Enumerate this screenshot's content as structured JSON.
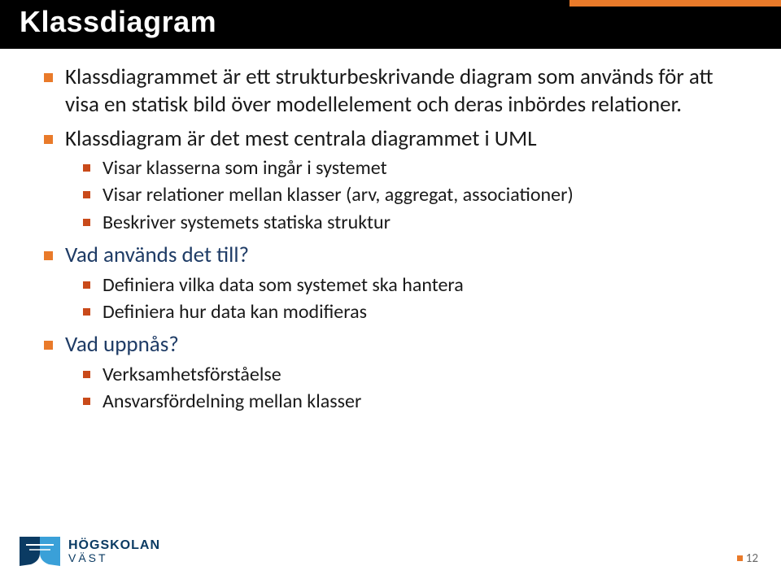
{
  "title": "Klassdiagram",
  "bullets": {
    "b1": "Klassdiagrammet är ett strukturbeskrivande diagram som används för att visa en statisk bild över modellelement och deras inbördes relationer.",
    "b2": "Klassdiagram är det mest centrala diagrammet i UML",
    "b2_sub": {
      "s1": "Visar klasserna som ingår i systemet",
      "s2": "Visar relationer mellan klasser (arv, aggregat, associationer)",
      "s3": "Beskriver systemets statiska struktur"
    },
    "b3": "Vad används det till?",
    "b3_sub": {
      "s1": "Definiera vilka data som systemet ska hantera",
      "s2": "Definiera hur data kan modifieras"
    },
    "b4": "Vad uppnås?",
    "b4_sub": {
      "s1": "Verksamhetsförståelse",
      "s2": "Ansvarsfördelning mellan klasser"
    }
  },
  "logo": {
    "line1": "HÖGSKOLAN",
    "line2": "VÄST"
  },
  "page_number": "12"
}
